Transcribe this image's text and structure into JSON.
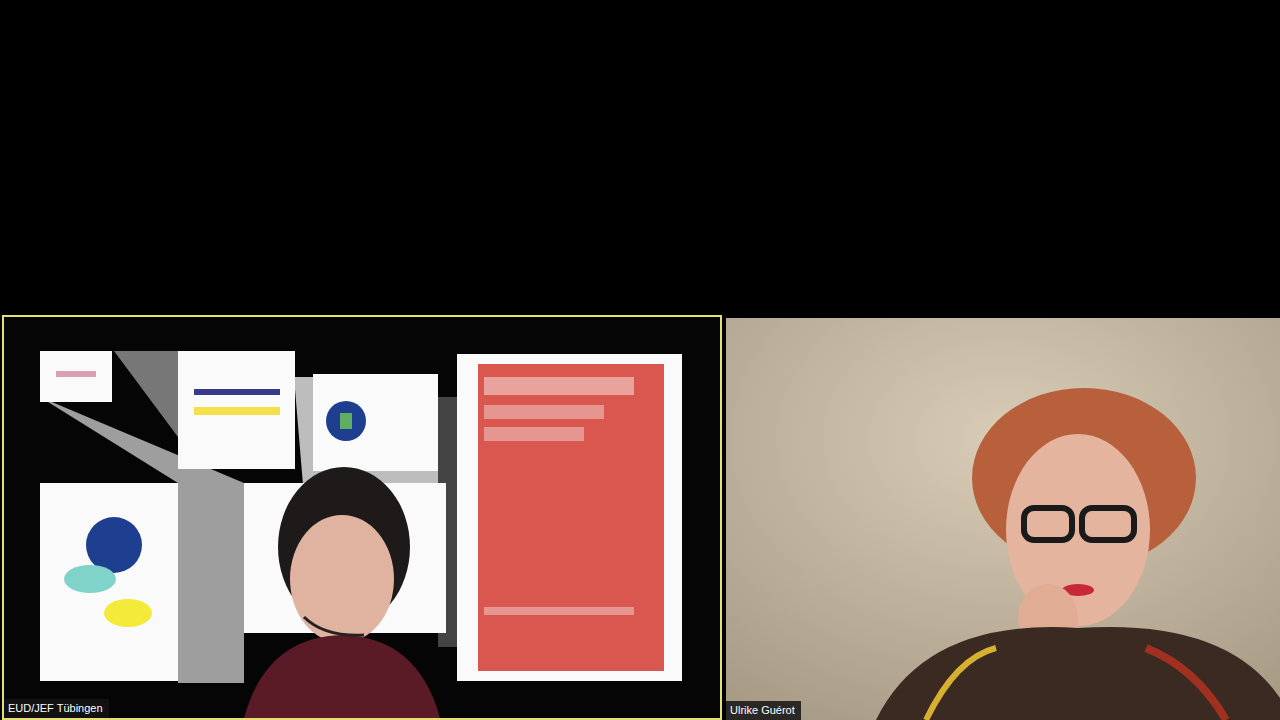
{
  "app": {
    "kind": "video-call"
  },
  "participants": [
    {
      "name": "EUD/JEF Tübingen",
      "active_speaker": true,
      "kind": "shared"
    },
    {
      "name": "Ulrike Guérot",
      "active_speaker": false,
      "kind": "camera"
    }
  ]
}
